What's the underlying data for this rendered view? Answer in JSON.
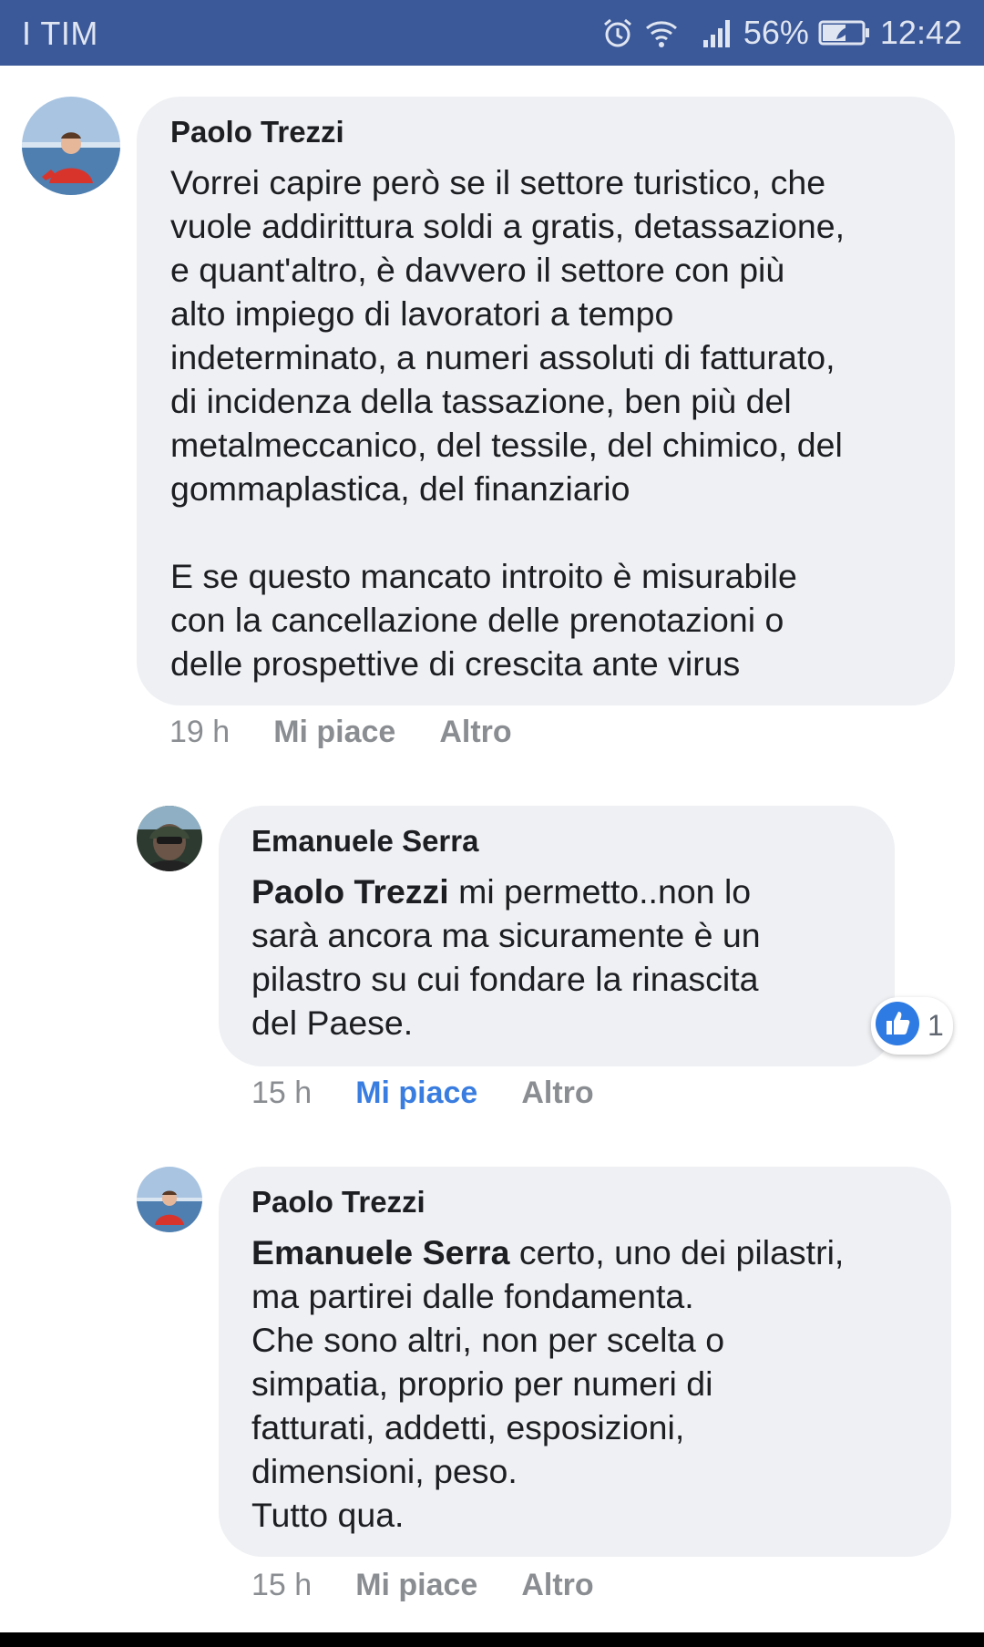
{
  "status_bar": {
    "carrier": "I TIM",
    "battery": "56%",
    "time": "12:42"
  },
  "colors": {
    "status_bg": "#3b5898",
    "bubble_bg": "#eef0f3",
    "link_blue": "#3a7de0",
    "meta_gray": "#8a8d91"
  },
  "comments": [
    {
      "author": "Paolo Trezzi",
      "text": "Vorrei capire però se il settore turistico, che\nvuole addirittura soldi a gratis, detassazione,\ne quant'altro, è davvero il settore con più\nalto impiego di lavoratori a tempo\nindeterminato, a numeri assoluti di fatturato,\ndi incidenza della tassazione, ben più del\nmetalmeccanico, del tessile, del chimico, del\ngommaplastica, del finanziario\n\nE se questo mancato introito è misurabile\ncon la cancellazione delle prenotazioni o\ndelle prospettive di crescita ante virus",
      "time": "19 h",
      "like": "Mi piace",
      "more": "Altro"
    },
    {
      "author": "Emanuele Serra",
      "mention": "Paolo Trezzi",
      "text": " mi permetto..non lo\nsarà ancora ma sicuramente è un\npilastro su cui fondare la rinascita\ndel Paese.",
      "time": "15 h",
      "like": "Mi piace",
      "more": "Altro",
      "reaction_count": "1"
    },
    {
      "author": "Paolo Trezzi",
      "mention": "Emanuele Serra",
      "text": " certo, uno dei pilastri,\nma partirei dalle fondamenta.\nChe sono altri, non per scelta o\nsimpatia, proprio per numeri di\nfatturati, addetti, esposizioni,\ndimensioni, peso.\nTutto qua.",
      "time": "15 h",
      "like": "Mi piace",
      "more": "Altro"
    }
  ]
}
